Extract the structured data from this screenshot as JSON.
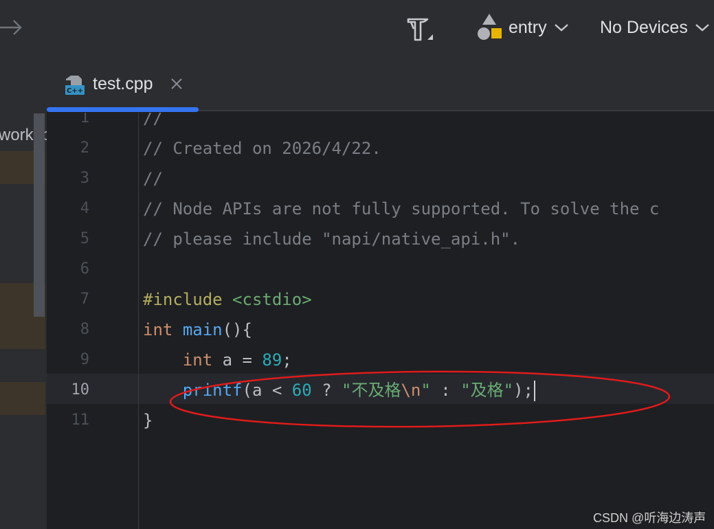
{
  "toolbar": {
    "build_icon": "hammer-icon",
    "run_config": {
      "icon": "shapes-icon",
      "label": "entry"
    },
    "device": {
      "label": "No Devices"
    },
    "colors": {
      "accent_yellow": "#e8b400",
      "icon_gray": "#c8cacf"
    }
  },
  "project_panel": {
    "partial_label": "worksp"
  },
  "tabs": [
    {
      "label": "test.cpp",
      "icon": "cpp-file-icon",
      "active": true,
      "close_icon": "close-icon"
    }
  ],
  "editor": {
    "active_line": "10",
    "lines": [
      {
        "num": "1",
        "tokens": [
          {
            "t": "//",
            "c": "cm"
          }
        ]
      },
      {
        "num": "2",
        "tokens": [
          {
            "t": "// Created on 2026/4/22.",
            "c": "cm"
          }
        ]
      },
      {
        "num": "3",
        "tokens": [
          {
            "t": "//",
            "c": "cm"
          }
        ]
      },
      {
        "num": "4",
        "tokens": [
          {
            "t": "// Node APIs are not fully supported. To solve the c",
            "c": "cm"
          }
        ]
      },
      {
        "num": "5",
        "tokens": [
          {
            "t": "// please include \"napi/native_api.h\".",
            "c": "cm"
          }
        ]
      },
      {
        "num": "6",
        "tokens": []
      },
      {
        "num": "7",
        "tokens": [
          {
            "t": "#include",
            "c": "pp"
          },
          {
            "t": " ",
            "c": ""
          },
          {
            "t": "<cstdio>",
            "c": "inc"
          }
        ]
      },
      {
        "num": "8",
        "tokens": [
          {
            "t": "int",
            "c": "kw"
          },
          {
            "t": " ",
            "c": ""
          },
          {
            "t": "main",
            "c": "fn"
          },
          {
            "t": "(){",
            "c": ""
          }
        ]
      },
      {
        "num": "9",
        "tokens": [
          {
            "t": "    ",
            "c": ""
          },
          {
            "t": "int",
            "c": "kw"
          },
          {
            "t": " a = ",
            "c": ""
          },
          {
            "t": "89",
            "c": "num"
          },
          {
            "t": ";",
            "c": ""
          }
        ]
      },
      {
        "num": "10",
        "tokens": [
          {
            "t": "    ",
            "c": ""
          },
          {
            "t": "printf",
            "c": "fn"
          },
          {
            "t": "(a < ",
            "c": ""
          },
          {
            "t": "60",
            "c": "num"
          },
          {
            "t": " ? ",
            "c": ""
          },
          {
            "t": "\"不及格",
            "c": "str"
          },
          {
            "t": "\\n",
            "c": "esc"
          },
          {
            "t": "\"",
            "c": "str"
          },
          {
            "t": " : ",
            "c": ""
          },
          {
            "t": "\"及格\"",
            "c": "str"
          },
          {
            "t": ");",
            "c": ""
          }
        ]
      },
      {
        "num": "11",
        "tokens": [
          {
            "t": "}",
            "c": ""
          }
        ]
      }
    ]
  },
  "annotation": {
    "shape": "ellipse",
    "color": "#e01b1b"
  },
  "watermark": "CSDN @听海边涛声"
}
